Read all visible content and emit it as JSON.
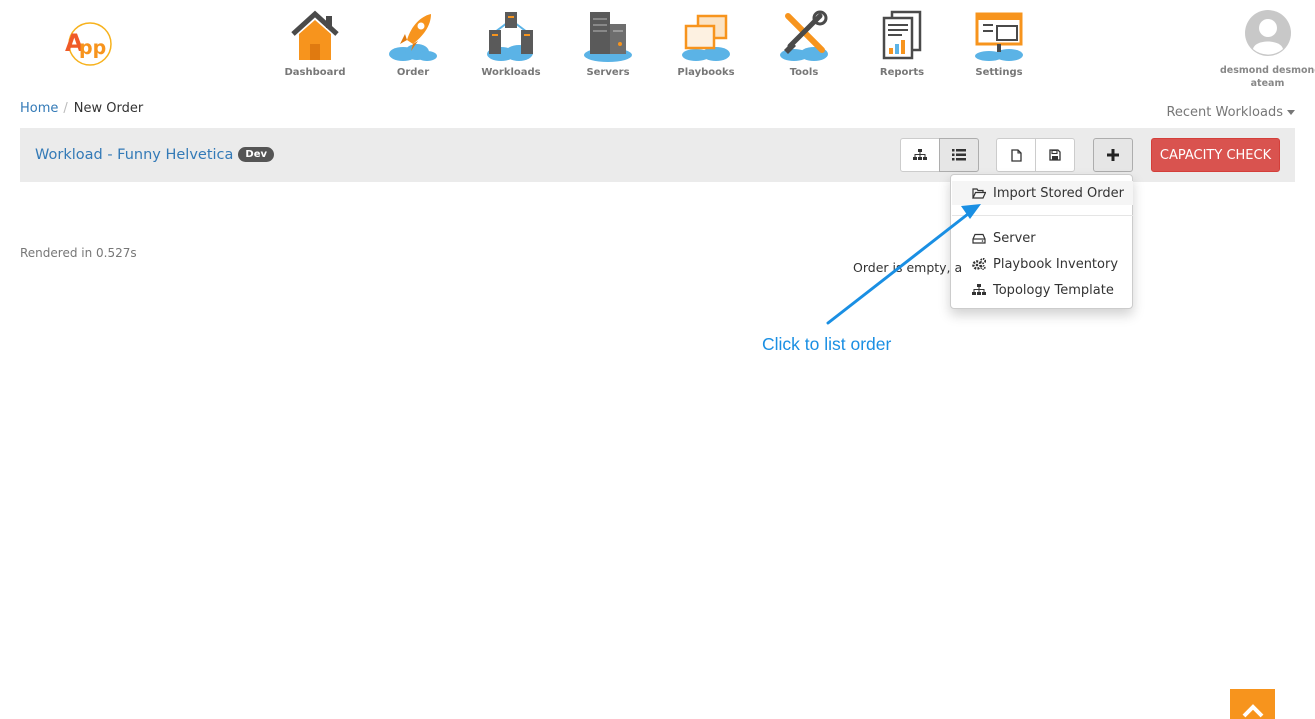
{
  "nav": {
    "items": [
      {
        "label": "Dashboard",
        "icon": "house-icon"
      },
      {
        "label": "Order",
        "icon": "rocket-icon"
      },
      {
        "label": "Workloads",
        "icon": "workloads-icon"
      },
      {
        "label": "Servers",
        "icon": "servers-icon"
      },
      {
        "label": "Playbooks",
        "icon": "playbooks-icon"
      },
      {
        "label": "Tools",
        "icon": "tools-icon"
      },
      {
        "label": "Reports",
        "icon": "reports-icon"
      },
      {
        "label": "Settings",
        "icon": "settings-icon"
      }
    ]
  },
  "logo": {
    "text": "App"
  },
  "user": {
    "name": "desmond desmond",
    "team": "ateam"
  },
  "breadcrumb": {
    "home": "Home",
    "separator": "/",
    "current": "New Order"
  },
  "recent_workloads": "Recent Workloads",
  "workload": {
    "title": "Workload - Funny Helvetica",
    "badge": "Dev"
  },
  "toolbar": {
    "capacity_label": "CAPACITY CHECK"
  },
  "dropdown": {
    "import": "Import Stored Order",
    "server": "Server",
    "playbook": "Playbook Inventory",
    "topology": "Topology Template"
  },
  "rendered_text": "Rendered in 0.527s",
  "empty_text": "Order is empty, a",
  "annotation": "Click to list order",
  "colors": {
    "accent_orange": "#f7941d",
    "link_blue": "#337ab7",
    "danger_red": "#d9534f",
    "annotation_blue": "#1a8fe3"
  }
}
